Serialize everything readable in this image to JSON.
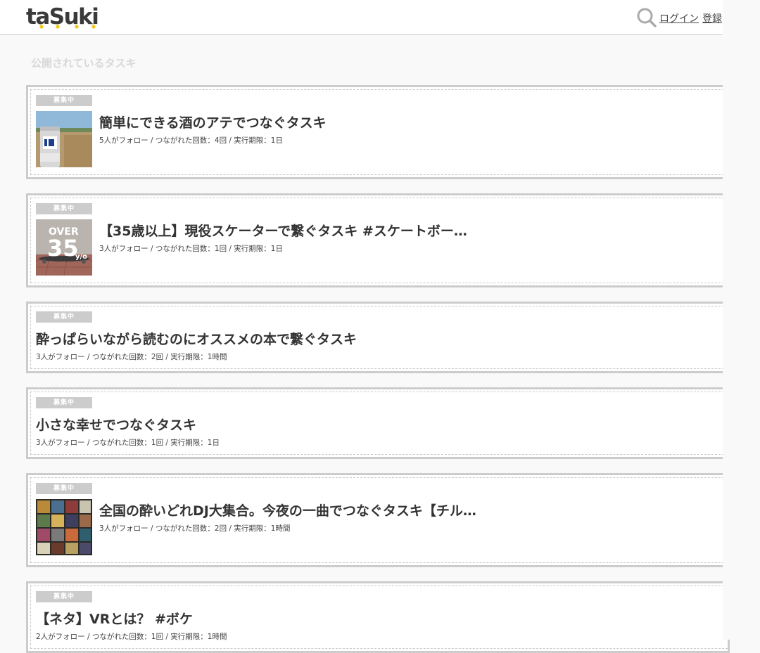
{
  "header": {
    "logo_text": "taSuki",
    "login_label": "ログイン",
    "register_label": "登録",
    "icons": [
      "search-icon"
    ]
  },
  "section": {
    "title": "公開されているタスキ"
  },
  "cards": [
    {
      "badge": "募集中",
      "title": "簡単にできる酒のアテでつなぐタスキ",
      "meta": "5人がフォロー / つながれた回数：4回 / 実行期限：1日",
      "thumb": "beer-can-riverside"
    },
    {
      "badge": "募集中",
      "title": "【35歳以上】現役スケーターで繋ぐタスキ #スケートボー…",
      "meta": "3人がフォロー / つながれた回数：1回 / 実行期限：1日",
      "thumb": "over-35-skateboard",
      "thumb_text": {
        "line1": "OVER",
        "line2": "35",
        "line3": "y/o"
      }
    },
    {
      "badge": "募集中",
      "title": "酔っぱらいながら読むのにオススメの本で繋ぐタスキ",
      "meta": "3人がフォロー / つながれた回数：2回 / 実行期限：1時間"
    },
    {
      "badge": "募集中",
      "title": "小さな幸せでつなぐタスキ",
      "meta": "3人がフォロー / つながれた回数：1回 / 実行期限：1日"
    },
    {
      "badge": "募集中",
      "title": "全国の酔いどれDJ大集合。今夜の一曲でつなぐタスキ【チル…",
      "meta": "3人がフォロー / つながれた回数：2回 / 実行期限：1時間",
      "thumb": "record-collection"
    },
    {
      "badge": "募集中",
      "title": "【ネタ】VRとは？ #ボケ",
      "meta": "2人がフォロー / つながれた回数：1回 / 実行期限：1時間"
    }
  ],
  "colors": {
    "accent_yellow": "#f5c518",
    "badge_gray": "#cccccc",
    "border_gray": "#cccccc"
  }
}
